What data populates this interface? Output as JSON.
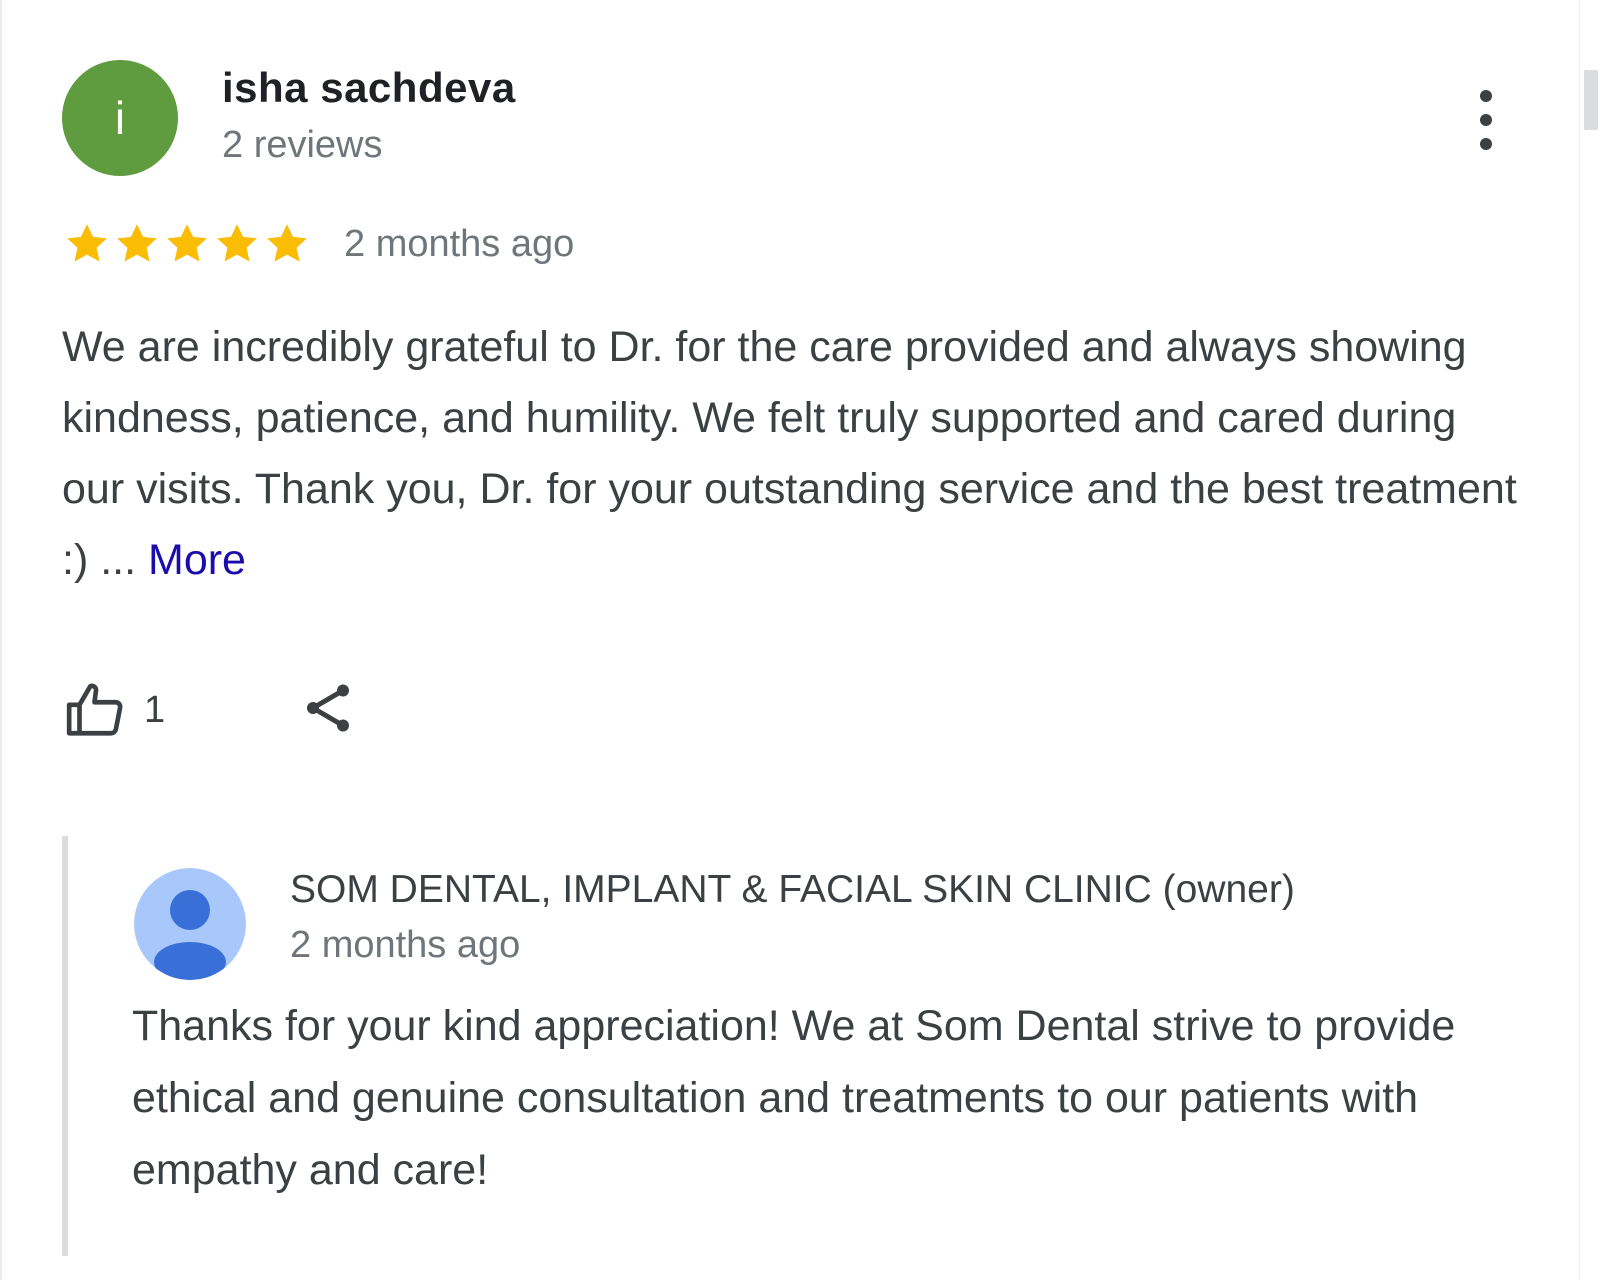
{
  "review": {
    "reviewer": {
      "avatar_letter": "i",
      "avatar_color": "#5f9c3f",
      "name": "isha sachdeva",
      "meta": "2 reviews"
    },
    "rating": 5,
    "star_color": "#fbbc04",
    "time": "2 months ago",
    "text": "We are incredibly grateful to Dr. for the care provided and always showing kindness, patience, and humility. We felt truly supported and cared during our visits. Thank you, Dr. for your outstanding service and the best treatment :) ... ",
    "more_label": "More",
    "likes": "1",
    "icons": {
      "more_options": "more-vert-icon",
      "like": "thumbs-up-icon",
      "share": "share-icon"
    }
  },
  "owner_response": {
    "name": "SOM DENTAL, IMPLANT & FACIAL SKIN CLINIC (owner)",
    "time": "2 months ago",
    "text": "Thanks for your kind appreciation! We at Som Dental strive to provide ethical and genuine consultation and treatments to our patients with empathy and care!",
    "avatar_bg": "#a8c7fa",
    "avatar_fg": "#3a6fd8",
    "avatar_icon": "person-icon"
  }
}
